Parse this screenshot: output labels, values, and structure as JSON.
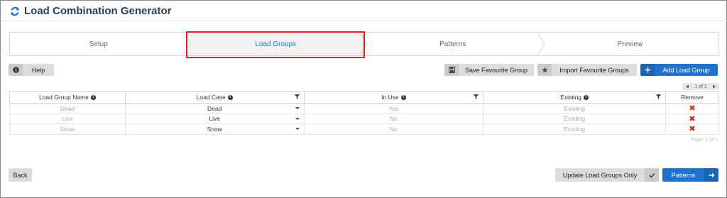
{
  "app": {
    "title": "Load Combination Generator"
  },
  "steps": [
    {
      "label": "Setup",
      "active": false
    },
    {
      "label": "Load Groups",
      "active": true
    },
    {
      "label": "Patterns",
      "active": false
    },
    {
      "label": "Preview",
      "active": false
    }
  ],
  "toolbar": {
    "help_label": "Help",
    "save_favourite_label": "Save Favourite Group",
    "import_favourite_label": "Import Favourite Groups",
    "add_group_label": "Add Load Group"
  },
  "pager": {
    "text": "1 of 1"
  },
  "table": {
    "columns": [
      "Load Group Name",
      "Load Case",
      "In Use",
      "Existing",
      "Remove"
    ],
    "rows": [
      {
        "name": "Dead",
        "load_case": "Dead",
        "in_use": "Yes",
        "existing": "Existing"
      },
      {
        "name": "Live",
        "load_case": "Live",
        "in_use": "No",
        "existing": "Existing"
      },
      {
        "name": "Snow",
        "load_case": "Snow",
        "in_use": "No",
        "existing": "Existing"
      }
    ],
    "page_info": "Page: 1 of 1"
  },
  "footer": {
    "back_label": "Back",
    "update_label": "Update Load Groups Only",
    "next_label": "Patterns"
  },
  "colors": {
    "accent": "#1e73d0",
    "highlight": "#e02020",
    "remove": "#e02020"
  },
  "icons": {
    "app_logo": "refresh-logo-icon",
    "help": "info-icon",
    "save": "floppy-disk-icon",
    "import": "star-icon",
    "add": "plus-icon",
    "filter": "filter-icon",
    "confirm": "check-icon",
    "next": "arrow-right-icon"
  }
}
